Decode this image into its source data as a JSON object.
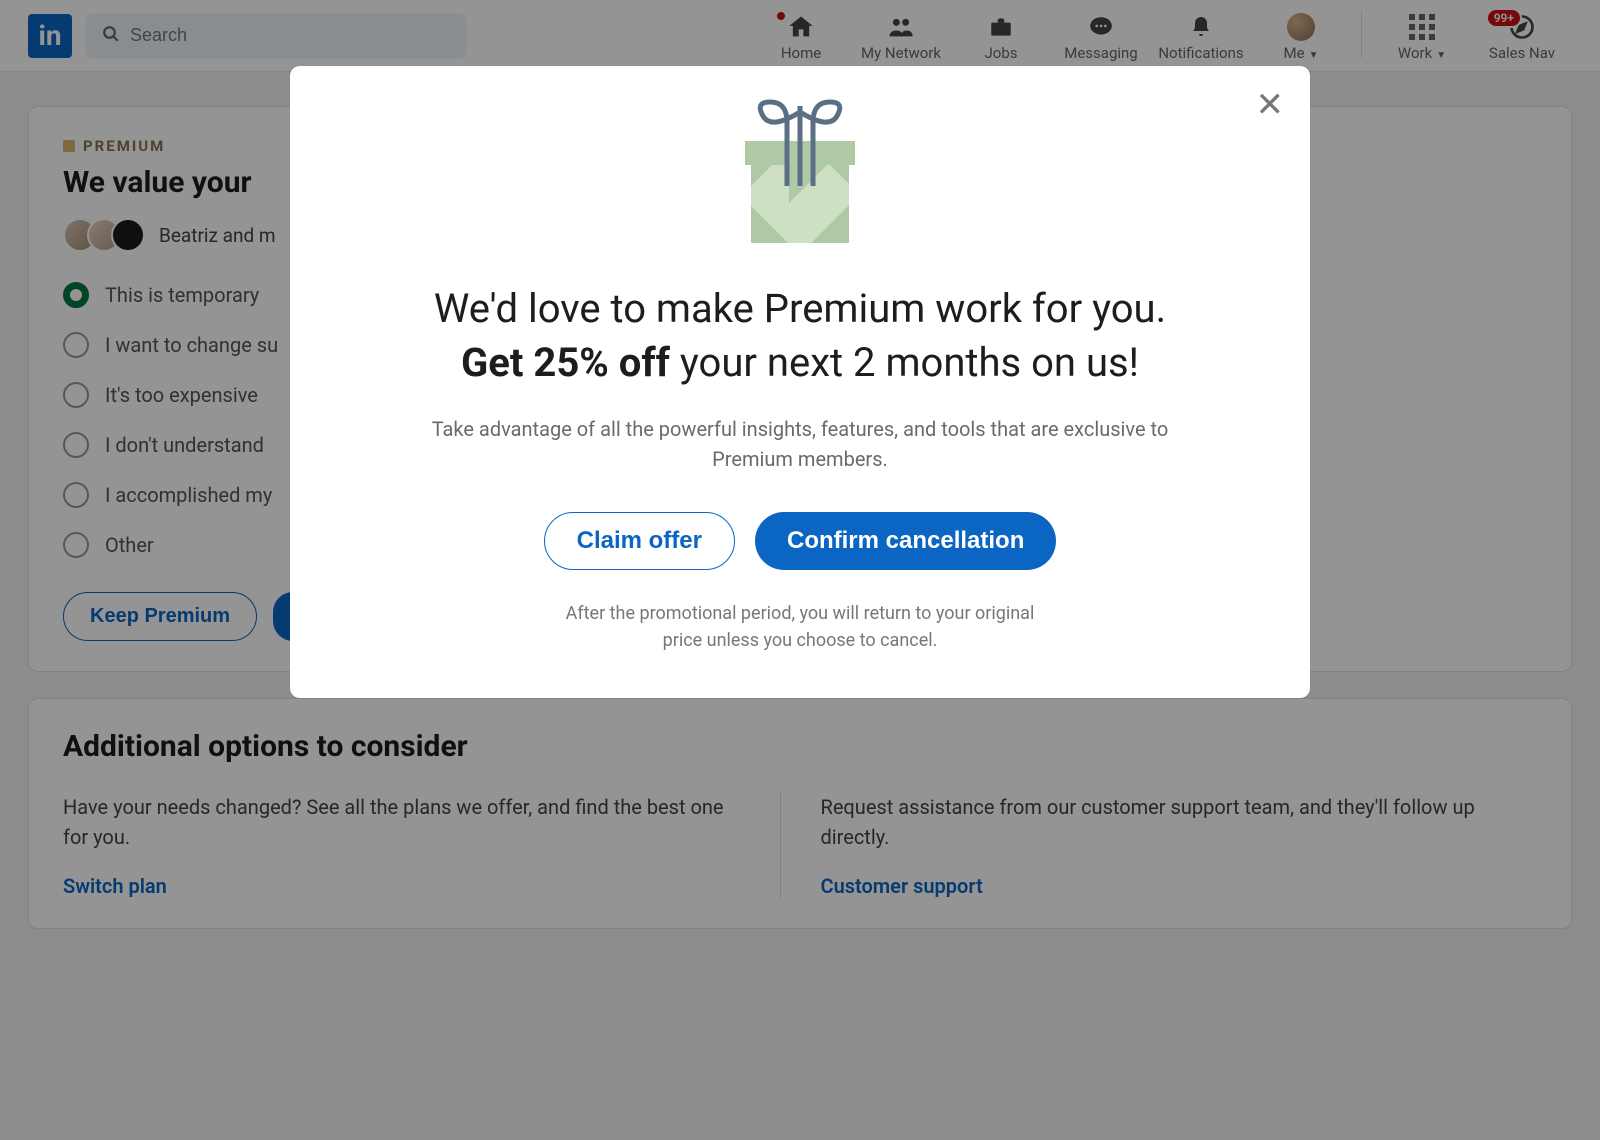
{
  "nav": {
    "search_placeholder": "Search",
    "items": {
      "home": "Home",
      "network": "My Network",
      "jobs": "Jobs",
      "messaging": "Messaging",
      "notifications": "Notifications",
      "me": "Me",
      "work": "Work",
      "sales": "Sales Nav"
    },
    "sales_badge": "99+"
  },
  "premium_card": {
    "tag": "PREMIUM",
    "title": "We value your",
    "friends_text": "Beatriz and m",
    "reasons": [
      "This is temporary",
      "I want to change su",
      "It's too expensive",
      "I don't understand",
      "I accomplished my",
      "Other"
    ],
    "selected_index": 0,
    "keep_btn": "Keep Premium"
  },
  "options_card": {
    "title": "Additional options to consider",
    "left_desc": "Have your needs changed? See all the plans we offer, and find the best one for you.",
    "left_link": "Switch plan",
    "right_desc": "Request assistance from our customer support team, and they'll follow up directly.",
    "right_link": "Customer support"
  },
  "modal": {
    "heading_pre": "We'd love to make Premium work for you. ",
    "heading_bold": "Get 25% off",
    "heading_post": " your next 2 months on us!",
    "sub": "Take advantage of all the powerful insights, features, and tools that are exclusive to Premium members.",
    "claim_btn": "Claim offer",
    "confirm_btn": "Confirm cancellation",
    "foot": "After the promotional period, you will return to your original price unless you choose to cancel."
  }
}
